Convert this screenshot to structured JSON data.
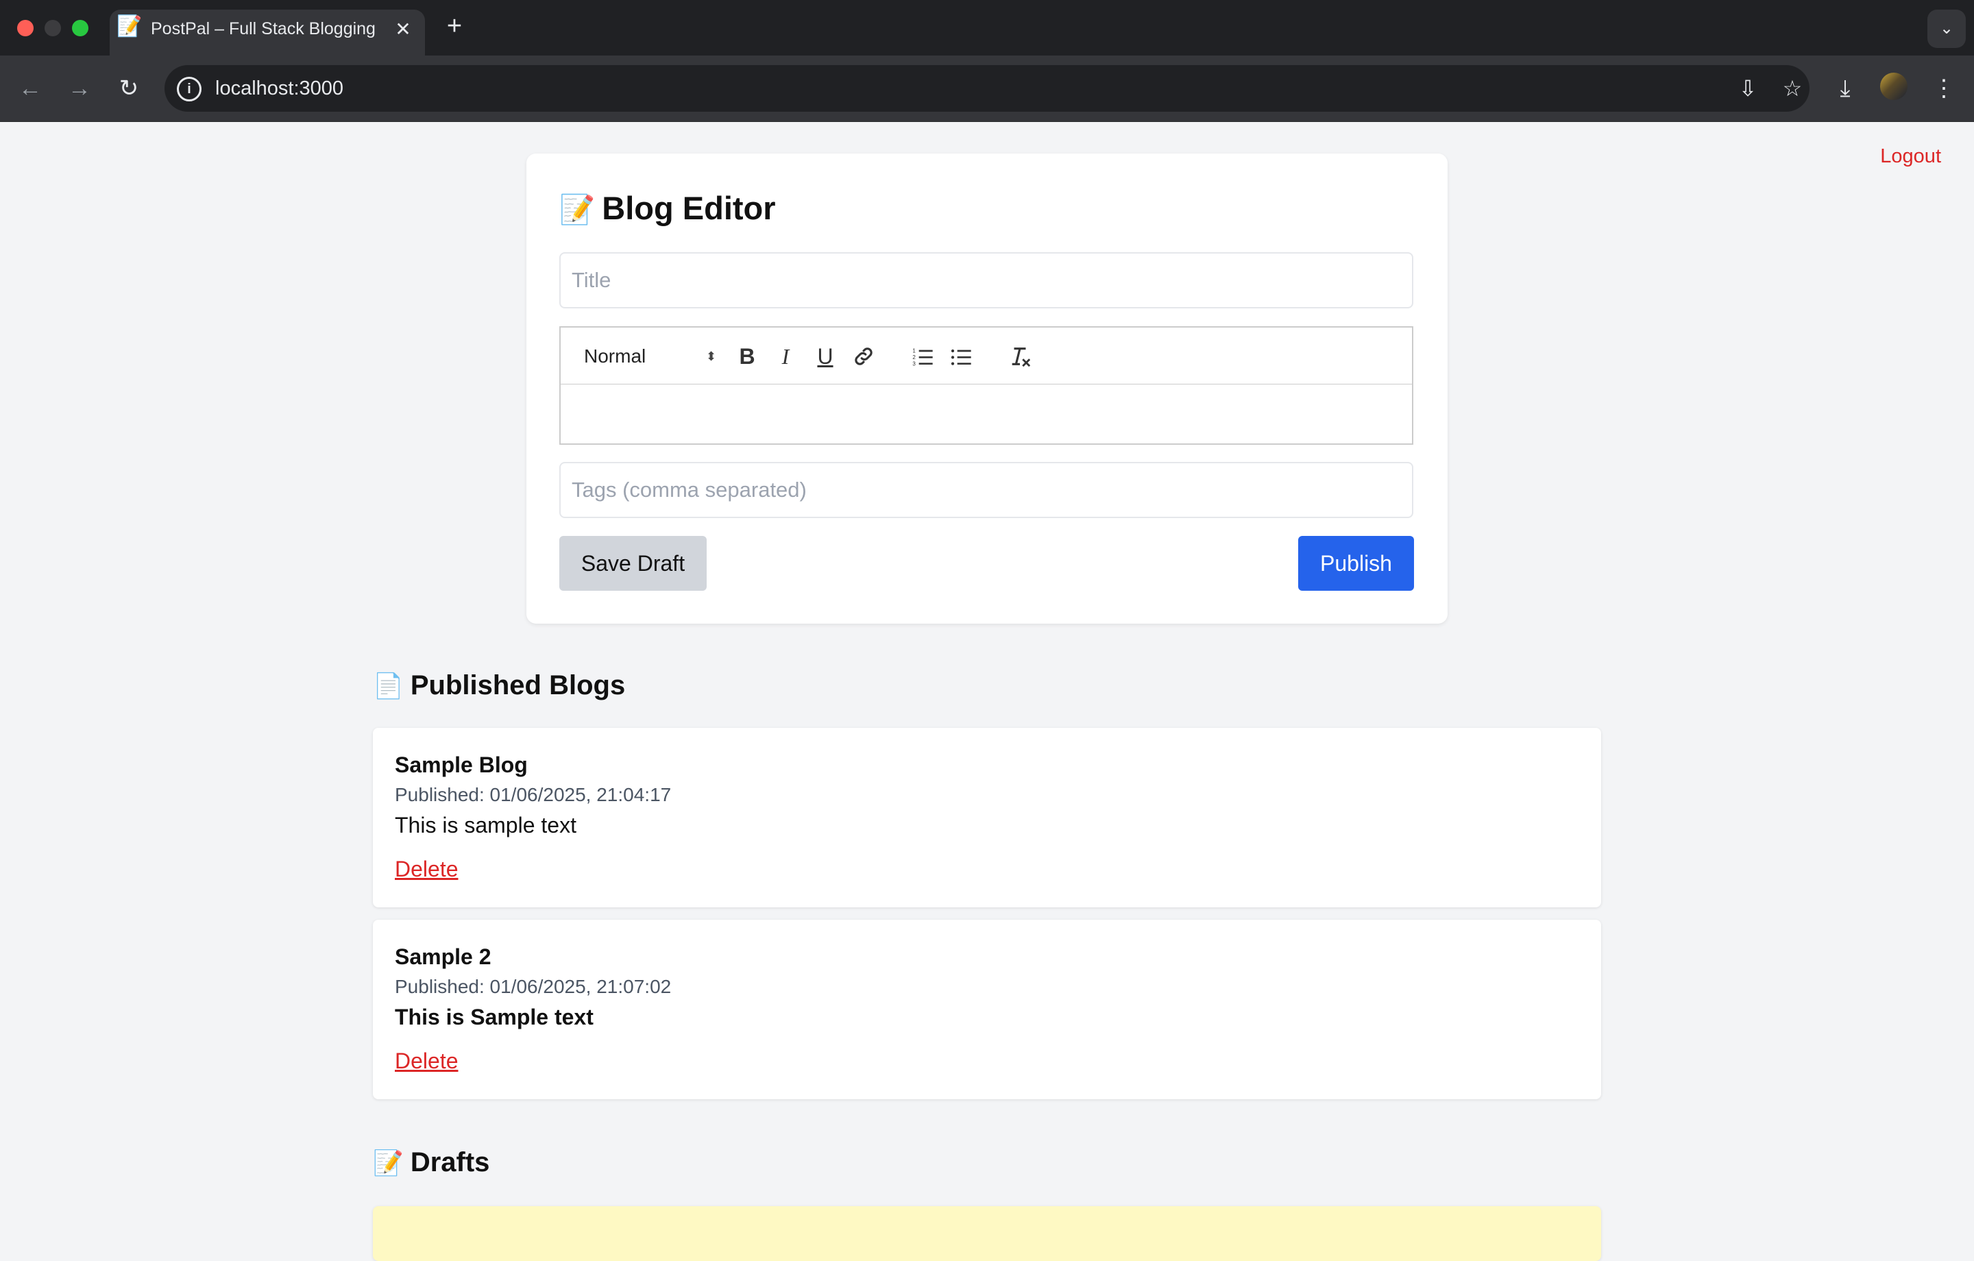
{
  "browser": {
    "tab_title": "PostPal – Full Stack Blogging",
    "tab_favicon": "📝",
    "url": "localhost:3000"
  },
  "page": {
    "logout_label": "Logout",
    "editor": {
      "heading_emoji": "📝",
      "heading": "Blog Editor",
      "title_placeholder": "Title",
      "title_value": "",
      "toolbar": {
        "format_select": "Normal",
        "buttons": [
          "bold",
          "italic",
          "underline",
          "link",
          "ordered-list",
          "bullet-list",
          "clear-format"
        ]
      },
      "body_value": "",
      "tags_placeholder": "Tags (comma separated)",
      "tags_value": "",
      "save_draft_label": "Save Draft",
      "publish_label": "Publish"
    },
    "published": {
      "heading_emoji": "📄",
      "heading": "Published Blogs",
      "posts": [
        {
          "title": "Sample Blog",
          "published": "Published: 01/06/2025, 21:04:17",
          "content": "This is sample text",
          "content_bold": false,
          "delete_label": "Delete"
        },
        {
          "title": "Sample 2",
          "published": "Published: 01/06/2025, 21:07:02",
          "content": "This is Sample text",
          "content_bold": true,
          "delete_label": "Delete"
        }
      ]
    },
    "drafts": {
      "heading_emoji": "📝",
      "heading": "Drafts"
    }
  },
  "colors": {
    "accent": "#2563eb",
    "danger": "#dc2626",
    "page_bg": "#f3f4f6",
    "draft_bg": "#fef9c3"
  }
}
